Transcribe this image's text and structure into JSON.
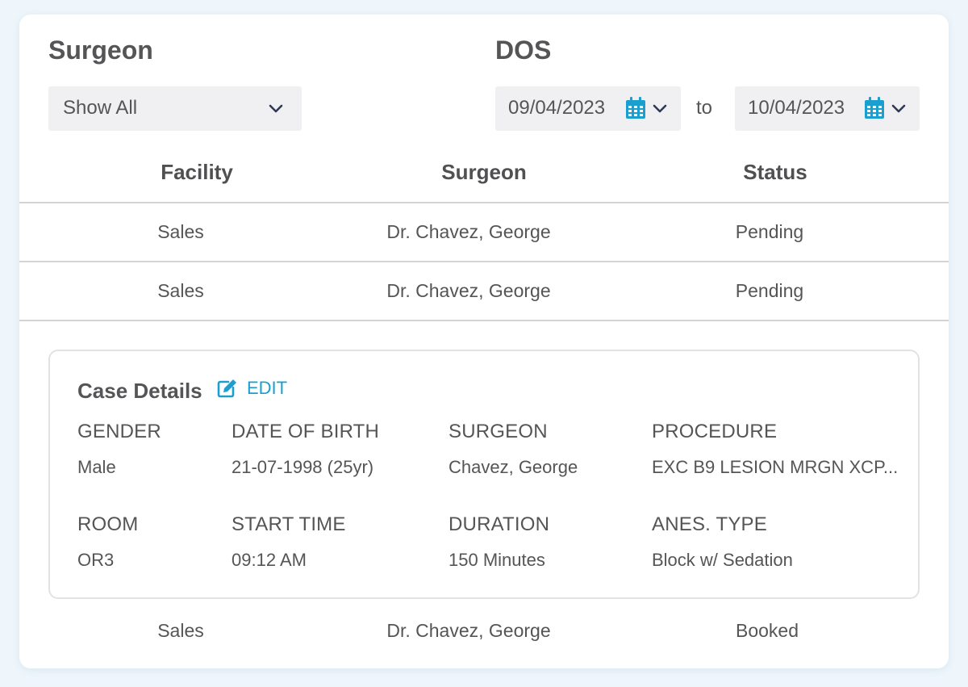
{
  "filters": {
    "surgeon_label": "Surgeon",
    "surgeon_value": "Show All",
    "dos_label": "DOS",
    "date_from": "09/04/2023",
    "date_to": "10/04/2023",
    "to_label": "to"
  },
  "table": {
    "headers": [
      "Facility",
      "Surgeon",
      "Status"
    ],
    "rows": [
      {
        "facility": "Sales",
        "surgeon": "Dr. Chavez, George",
        "status": "Pending"
      },
      {
        "facility": "Sales",
        "surgeon": "Dr. Chavez, George",
        "status": "Pending"
      },
      {
        "facility": "Sales",
        "surgeon": "Dr. Chavez, George",
        "status": "Booked"
      }
    ]
  },
  "case_details": {
    "title": "Case Details",
    "edit_label": "EDIT",
    "fields": [
      {
        "label": "GENDER",
        "value": "Male"
      },
      {
        "label": "DATE OF BIRTH",
        "value": "21-07-1998 (25yr)"
      },
      {
        "label": "SURGEON",
        "value": "Chavez, George"
      },
      {
        "label": "PROCEDURE",
        "value": "EXC B9 LESION MRGN XCP..."
      },
      {
        "label": "ROOM",
        "value": "OR3"
      },
      {
        "label": "START TIME",
        "value": "09:12 AM"
      },
      {
        "label": "DURATION",
        "value": "150 Minutes"
      },
      {
        "label": "ANES. TYPE",
        "value": "Block w/ Sedation"
      }
    ]
  },
  "colors": {
    "accent": "#1a9fcf",
    "select_bg": "#f0f0f2",
    "page_bg": "#eef6fb"
  },
  "icons": {
    "chevron": "chevron-down-icon",
    "calendar": "calendar-icon",
    "edit": "edit-icon"
  }
}
